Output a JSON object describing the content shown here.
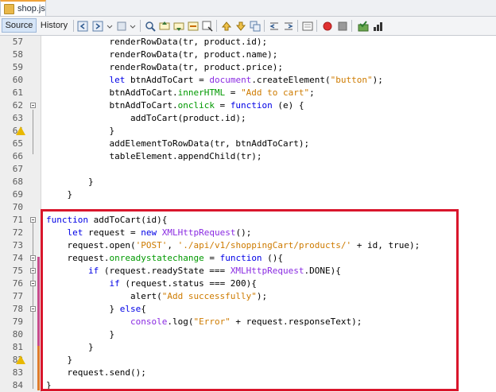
{
  "file_tab": {
    "label": "shop.js"
  },
  "toolbar": {
    "source_label": "Source",
    "history_label": "History"
  },
  "icons": [
    "back-icon",
    "forward-icon",
    "find-icon",
    "prev-occurrence-icon",
    "next-occurrence-icon",
    "toggle-highlight-icon",
    "shift-left-icon",
    "shift-right-icon",
    "comment-icon",
    "uncomment-icon",
    "record-macro-icon",
    "stop-macro-icon",
    "start-macro-icon",
    "bookmark-icon"
  ],
  "colors": {
    "keyword": "#0000e6",
    "string": "#ce7b00",
    "property": "#009900",
    "global": "#8a2be2",
    "highlight_border": "#d9162c"
  },
  "lines": [
    {
      "n": "57",
      "text": "            renderRowData(tr, product.id);"
    },
    {
      "n": "58",
      "text": "            renderRowData(tr, product.name);"
    },
    {
      "n": "59",
      "text": "            renderRowData(tr, product.price);"
    },
    {
      "n": "60",
      "text": "            let btnAddToCart = document.createElement(\"button\");"
    },
    {
      "n": "61",
      "text": "            btnAddToCart.innerHTML = \"Add to cart\";"
    },
    {
      "n": "62",
      "text": "            btnAddToCart.onclick = function (e) {"
    },
    {
      "n": "63",
      "text": "                addToCart(product.id);"
    },
    {
      "n": "64",
      "text": "            }"
    },
    {
      "n": "65",
      "text": "            addElementToRowData(tr, btnAddToCart);"
    },
    {
      "n": "66",
      "text": "            tableElement.appendChild(tr);"
    },
    {
      "n": "67",
      "text": ""
    },
    {
      "n": "68",
      "text": "        }"
    },
    {
      "n": "69",
      "text": "    }"
    },
    {
      "n": "70",
      "text": ""
    },
    {
      "n": "71",
      "text": "function addToCart(id){"
    },
    {
      "n": "72",
      "text": "    let request = new XMLHttpRequest();"
    },
    {
      "n": "73",
      "text": "    request.open('POST', './api/v1/shoppingCart/products/' + id, true);"
    },
    {
      "n": "74",
      "text": "    request.onreadystatechange = function (){"
    },
    {
      "n": "75",
      "text": "        if (request.readyState === XMLHttpRequest.DONE){"
    },
    {
      "n": "76",
      "text": "            if (request.status === 200){"
    },
    {
      "n": "77",
      "text": "                alert(\"Add successfully\");"
    },
    {
      "n": "78",
      "text": "            } else{"
    },
    {
      "n": "79",
      "text": "                console.log(\"Error\" + request.responseText);"
    },
    {
      "n": "80",
      "text": "            }"
    },
    {
      "n": "81",
      "text": "        }"
    },
    {
      "n": "82",
      "text": "    }"
    },
    {
      "n": "83",
      "text": "    request.send();"
    },
    {
      "n": "84",
      "text": "}"
    }
  ]
}
